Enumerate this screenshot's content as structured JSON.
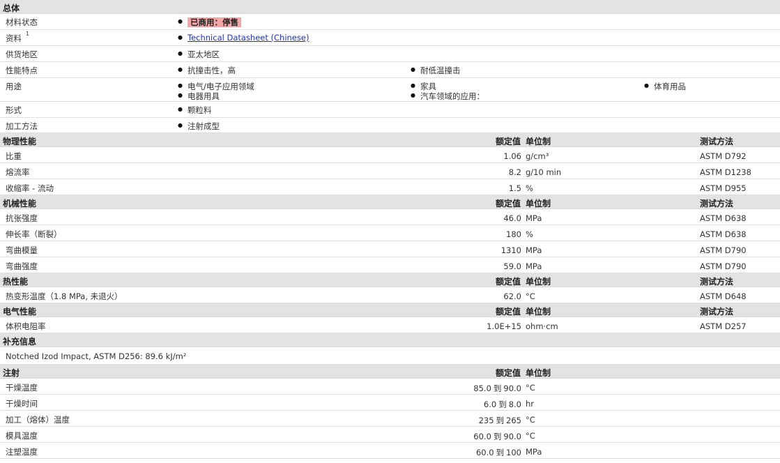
{
  "overview": {
    "title": "总体",
    "status_label": "材料状态",
    "status_value": "已商用：停售",
    "docs_label": "资料",
    "docs_sup": "1",
    "docs_link": "Technical Datasheet (Chinese)",
    "region_label": "供货地区",
    "region_value": "亚太地区",
    "features_label": "性能特点",
    "features": [
      "抗撞击性，高",
      "耐低温撞击"
    ],
    "uses_label": "用途",
    "uses": [
      "电气/电子应用领域",
      "家具",
      "体育用品",
      "电器用具",
      "汽车领域的应用："
    ],
    "form_label": "形式",
    "form_value": "颗粒料",
    "process_label": "加工方法",
    "process_value": "注射成型"
  },
  "header_labels": {
    "nominal": "额定值",
    "unit": "单位制",
    "test": "测试方法"
  },
  "physical": {
    "title": "物理性能",
    "rows": [
      {
        "name": "比重",
        "value": "1.06",
        "unit": "g/cm³",
        "test": "ASTM D792"
      },
      {
        "name": "熔流率",
        "value": "8.2",
        "unit": "g/10 min",
        "test": "ASTM D1238"
      },
      {
        "name": "收缩率 - 流动",
        "value": "1.5",
        "unit": "%",
        "test": "ASTM D955"
      }
    ]
  },
  "mechanical": {
    "title": "机械性能",
    "rows": [
      {
        "name": "抗张强度",
        "value": "46.0",
        "unit": "MPa",
        "test": "ASTM D638"
      },
      {
        "name": "伸长率（断裂）",
        "value": "180",
        "unit": "%",
        "test": "ASTM D638"
      },
      {
        "name": "弯曲模量",
        "value": "1310",
        "unit": "MPa",
        "test": "ASTM D790"
      },
      {
        "name": "弯曲强度",
        "value": "59.0",
        "unit": "MPa",
        "test": "ASTM D790"
      }
    ]
  },
  "thermal": {
    "title": "热性能",
    "rows": [
      {
        "name": "热变形温度（1.8 MPa, 未退火）",
        "value": "62.0",
        "unit": "°C",
        "test": "ASTM D648"
      }
    ]
  },
  "electrical": {
    "title": "电气性能",
    "rows": [
      {
        "name": "体积电阻率",
        "value": "1.0E+15",
        "unit": "ohm·cm",
        "test": "ASTM D257"
      }
    ]
  },
  "supplement": {
    "title": "补充信息",
    "note": "Notched Izod Impact, ASTM D256: 89.6 kJ/m²"
  },
  "injection": {
    "title": "注射",
    "to": "到",
    "rows": [
      {
        "name": "干燥温度",
        "from": "85.0",
        "to_val": "90.0",
        "unit": "°C"
      },
      {
        "name": "干燥时间",
        "from": "6.0",
        "to_val": "8.0",
        "unit": "hr"
      },
      {
        "name": "加工（熔体）温度",
        "from": "235",
        "to_val": "265",
        "unit": "°C"
      },
      {
        "name": "模具温度",
        "from": "60.0",
        "to_val": "90.0",
        "unit": "°C"
      },
      {
        "name": "注塑温度",
        "from": "60.0",
        "to_val": "100",
        "unit": "MPa"
      }
    ]
  }
}
